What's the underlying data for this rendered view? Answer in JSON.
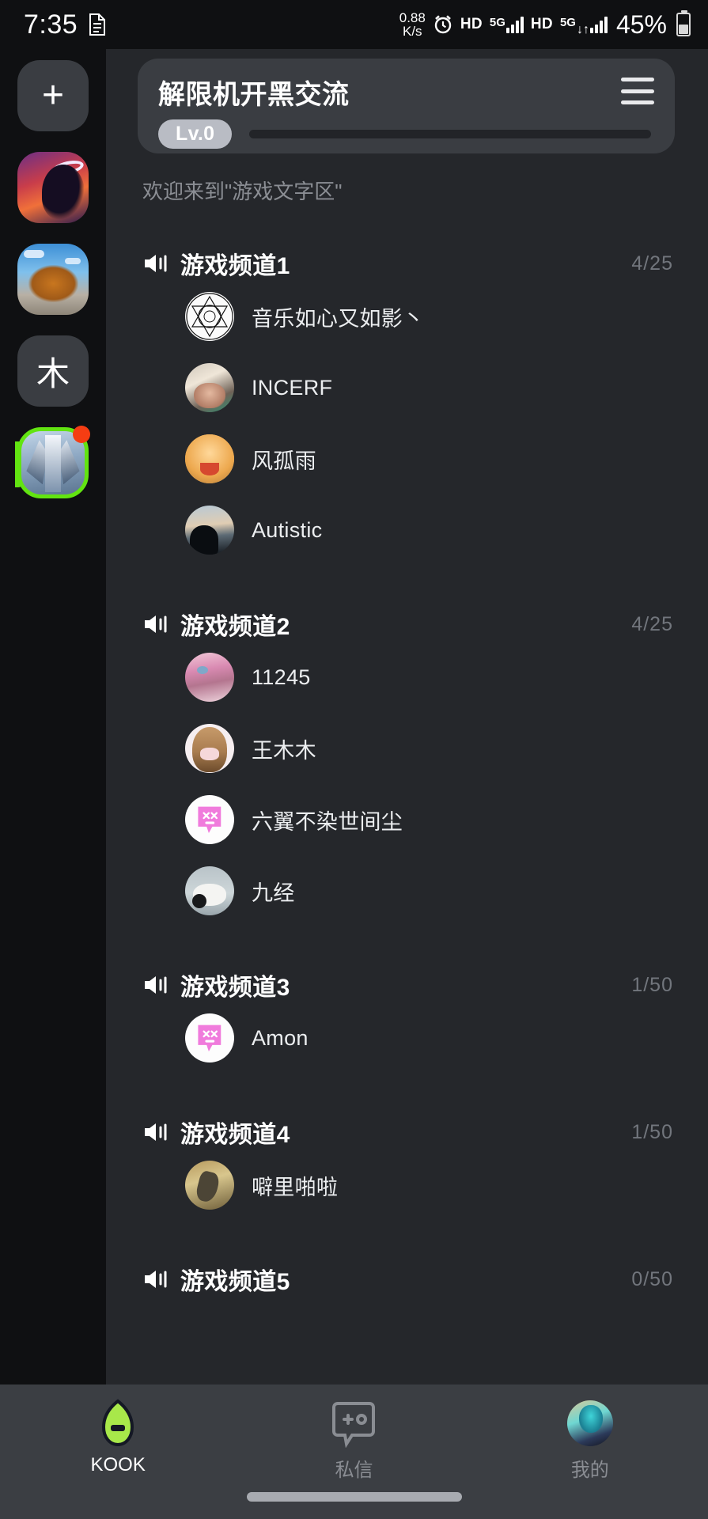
{
  "status_bar": {
    "time": "7:35",
    "doc_icon": "document-icon",
    "network_speed_value": "0.88",
    "network_speed_unit": "K/s",
    "alarm_icon": "alarm-clock-icon",
    "hd_label_1": "HD",
    "signal_label_1": "5G",
    "hd_label_2": "HD",
    "signal_label_2": "5G",
    "data_arrows": "↓↑",
    "battery_percent": "45%"
  },
  "server_rail": {
    "add_button_label": "+",
    "items": [
      {
        "name": "add-server",
        "label": "+",
        "type": "button"
      },
      {
        "name": "server-angel",
        "label": "",
        "type": "image"
      },
      {
        "name": "server-cat",
        "label": "",
        "type": "image"
      },
      {
        "name": "server-mu",
        "label": "木",
        "type": "text"
      },
      {
        "name": "server-mecha",
        "label": "",
        "type": "image",
        "selected": true,
        "has_unread": true
      }
    ]
  },
  "header": {
    "title": "解限机开黑交流",
    "menu_icon": "hamburger-menu-icon",
    "level_badge": "Lv.0",
    "level_progress": 0
  },
  "welcome_text": "欢迎来到\"游戏文字区\"",
  "channels": [
    {
      "name": "游戏频道1",
      "count": "4/25",
      "icon": "speaker-icon",
      "members": [
        {
          "name": "音乐如心又如影丶",
          "avatar": "sigil"
        },
        {
          "name": "INCERF",
          "avatar": "incerf"
        },
        {
          "name": "风孤雨",
          "avatar": "fgy"
        },
        {
          "name": "Autistic",
          "avatar": "autistic"
        }
      ]
    },
    {
      "name": "游戏频道2",
      "count": "4/25",
      "icon": "speaker-icon",
      "members": [
        {
          "name": "11245",
          "avatar": "a11245"
        },
        {
          "name": "王木木",
          "avatar": "wmm"
        },
        {
          "name": "六翼不染世间尘",
          "avatar": "kook"
        },
        {
          "name": "九经",
          "avatar": "panda"
        }
      ]
    },
    {
      "name": "游戏频道3",
      "count": "1/50",
      "icon": "speaker-icon",
      "members": [
        {
          "name": "Amon",
          "avatar": "kook"
        }
      ]
    },
    {
      "name": "游戏频道4",
      "count": "1/50",
      "icon": "speaker-icon",
      "members": [
        {
          "name": "噼里啪啦",
          "avatar": "pp"
        }
      ]
    },
    {
      "name": "游戏频道5",
      "count": "0/50",
      "icon": "speaker-icon",
      "members": []
    }
  ],
  "bottom_nav": {
    "items": [
      {
        "label": "KOOK",
        "icon": "kook-logo-icon",
        "active": true
      },
      {
        "label": "私信",
        "icon": "message-icon",
        "active": false
      },
      {
        "label": "我的",
        "icon": "profile-avatar",
        "active": false
      }
    ]
  },
  "colors": {
    "accent_green": "#62e411",
    "panel_bg": "#25272b",
    "rail_bg": "#0f1012",
    "card_bg": "#3a3d42",
    "nav_bg": "#3b3e43",
    "unread_red": "#f53d13",
    "muted_text": "#72767d"
  }
}
